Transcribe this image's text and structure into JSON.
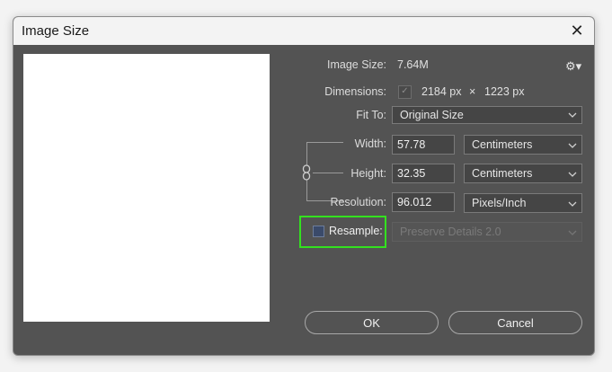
{
  "window": {
    "title": "Image Size"
  },
  "info": {
    "image_size_label": "Image Size:",
    "image_size_value": "7.64M",
    "dimensions_label": "Dimensions:",
    "dimensions_width": "2184 px",
    "dimensions_times": "×",
    "dimensions_height": "1223 px"
  },
  "fit_to": {
    "label": "Fit To:",
    "value": "Original Size"
  },
  "width": {
    "label": "Width:",
    "value": "57.78",
    "unit": "Centimeters"
  },
  "height": {
    "label": "Height:",
    "value": "32.35",
    "unit": "Centimeters"
  },
  "resolution": {
    "label": "Resolution:",
    "value": "96.012",
    "unit": "Pixels/Inch"
  },
  "resample": {
    "label": "Resample:",
    "checked": false,
    "method": "Preserve Details 2.0"
  },
  "buttons": {
    "ok": "OK",
    "cancel": "Cancel"
  },
  "colors": {
    "dialog_bg": "#535353",
    "highlight": "#33e11f"
  }
}
